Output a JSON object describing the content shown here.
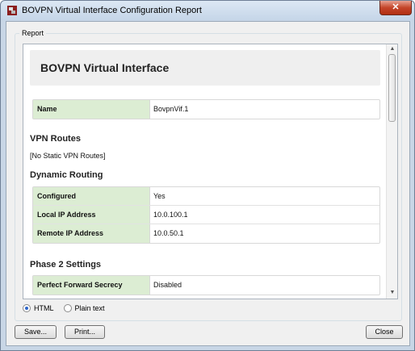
{
  "window": {
    "title": "BOVPN Virtual Interface Configuration Report",
    "close_glyph": "✕"
  },
  "report": {
    "group_label": "Report",
    "heading": "BOVPN Virtual Interface",
    "name_table": [
      {
        "key": "Name",
        "value": "BovpnVif.1"
      }
    ],
    "vpn_routes": {
      "title": "VPN Routes",
      "text": "[No Static VPN Routes]"
    },
    "dynamic_routing": {
      "title": "Dynamic Routing",
      "rows": [
        {
          "key": "Configured",
          "value": "Yes"
        },
        {
          "key": "Local IP Address",
          "value": "10.0.100.1"
        },
        {
          "key": "Remote IP Address",
          "value": "10.0.50.1"
        }
      ]
    },
    "phase2": {
      "title": "Phase 2 Settings",
      "rows": [
        {
          "key": "Perfect Forward Secrecy",
          "value": "Disabled"
        }
      ]
    }
  },
  "format": {
    "html_label": "HTML",
    "plain_label": "Plain text",
    "selected": "HTML"
  },
  "buttons": {
    "save": "Save...",
    "print": "Print...",
    "close": "Close"
  },
  "colors": {
    "key_cell_bg": "#dcedd3",
    "title_bar": "#c5d5e8"
  }
}
